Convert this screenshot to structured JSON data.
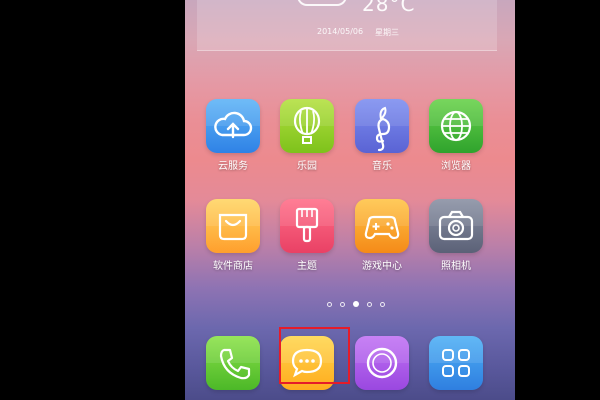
{
  "status": {
    "temperature": "28°C",
    "date": "2014/05/06",
    "weekday": "星期三"
  },
  "apps": [
    {
      "label": "云服务",
      "icon": "cloud-upload-icon"
    },
    {
      "label": "乐园",
      "icon": "hot-air-balloon-icon"
    },
    {
      "label": "音乐",
      "icon": "treble-clef-icon"
    },
    {
      "label": "浏览器",
      "icon": "globe-icon"
    },
    {
      "label": "软件商店",
      "icon": "shopping-bag-icon"
    },
    {
      "label": "主题",
      "icon": "paint-brush-icon"
    },
    {
      "label": "游戏中心",
      "icon": "gamepad-icon"
    },
    {
      "label": "照相机",
      "icon": "camera-icon"
    }
  ],
  "dock": [
    {
      "icon": "phone-icon"
    },
    {
      "icon": "message-bubble-icon"
    },
    {
      "icon": "circle-icon"
    },
    {
      "icon": "app-grid-icon"
    }
  ],
  "page_indicator": {
    "count": 5,
    "active": 3
  },
  "colors": {
    "highlight_box": "#e51c2a",
    "wallpaper_top": "#c8a7bd",
    "wallpaper_bottom": "#4c4c8a"
  }
}
